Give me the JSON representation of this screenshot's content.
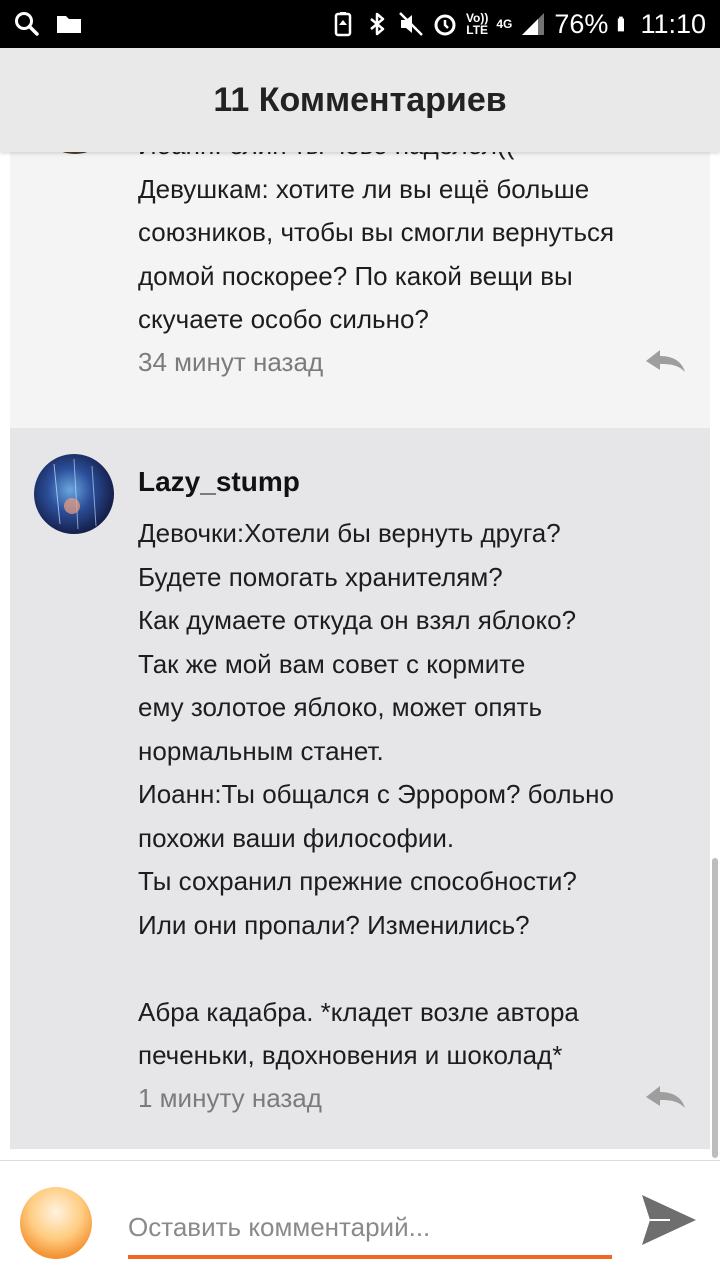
{
  "status_bar": {
    "battery_percent": "76%",
    "time": "11:10",
    "network_4g": "4G",
    "volte_top": "Vo))",
    "volte_bottom": "LTE"
  },
  "header": {
    "title": "11 Комментариев"
  },
  "comments": [
    {
      "author": "",
      "body": "Иоанн: блин ты чево наделол((\nДевушкам: хотите ли вы ещё больше союзников, чтобы вы смогли вернуться домой поскорее? По какой вещи вы скучаете особо сильно?",
      "time": "34 минут назад"
    },
    {
      "author": "Lazy_stump",
      "body": "Девочки:Хотели бы вернуть друга?\nБудете помогать хранителям?\nКак думаете откуда он взял яблоко?\nТак же мой вам совет с кормите\nему золотое яблоко, может опять\nнормальным станет.\nИоанн:Ты общался с Эррором?  больно\nпохожи ваши философии.\nТы сохранил прежние способности?\nИли они пропали? Изменились?\n\nАбра кадабра. *кладет возле автора\nпеченьки, вдохновения и шоколад*",
      "time": "1 минуту назад"
    }
  ],
  "composer": {
    "placeholder": "Оставить комментарий..."
  },
  "colors": {
    "accent": "#f26522",
    "header_bg": "#e9e9e9",
    "comment_bg": "#e6e6e9"
  },
  "icons": [
    "search-icon",
    "folder-icon",
    "bluetooth-icon",
    "mute-icon",
    "alarm-icon",
    "signal-icon",
    "battery-icon",
    "reply-icon",
    "send-icon"
  ]
}
